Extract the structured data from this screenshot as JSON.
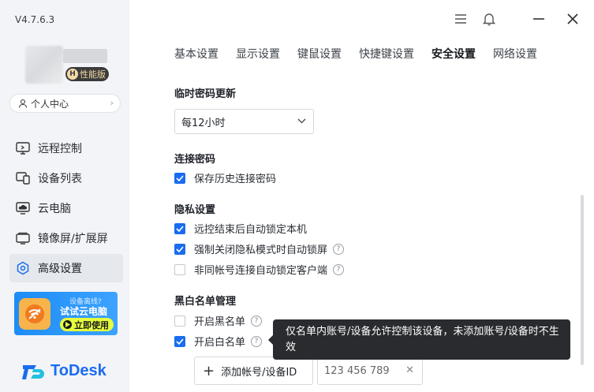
{
  "app": {
    "version": "V4.7.6.3",
    "badge_letter": "H",
    "badge_label": "性能版",
    "profile_label": "个人中心",
    "brand": "ToDesk"
  },
  "sidebar": {
    "items": [
      {
        "label": "远程控制",
        "icon": "monitor-icon"
      },
      {
        "label": "设备列表",
        "icon": "devices-icon"
      },
      {
        "label": "云电脑",
        "icon": "cloud-pc-icon"
      },
      {
        "label": "镜像屏/扩展屏",
        "icon": "mirror-screen-icon"
      },
      {
        "label": "高级设置",
        "icon": "settings-hex-icon",
        "active": true
      }
    ],
    "promo": {
      "line1": "设备离线?",
      "line2": "试试云电脑",
      "line3": "立即使用"
    }
  },
  "tabs": [
    {
      "label": "基本设置"
    },
    {
      "label": "显示设置"
    },
    {
      "label": "键鼠设置"
    },
    {
      "label": "快捷键设置"
    },
    {
      "label": "安全设置",
      "active": true
    },
    {
      "label": "网络设置"
    }
  ],
  "security": {
    "temp_password": {
      "title": "临时密码更新",
      "selected": "每12小时"
    },
    "connect_password": {
      "title": "连接密码",
      "save_history": {
        "label": "保存历史连接密码",
        "checked": true
      }
    },
    "privacy": {
      "title": "隐私设置",
      "auto_lock": {
        "label": "远控结束后自动锁定本机",
        "checked": true
      },
      "force_lock": {
        "label": "强制关闭隐私模式时自动锁屏",
        "checked": true
      },
      "diff_account_lock": {
        "label": "非同帐号连接自动锁定客户端",
        "checked": false
      }
    },
    "blackwhite": {
      "title": "黑白名单管理",
      "blacklist": {
        "label": "开启黑名单",
        "checked": false
      },
      "whitelist": {
        "label": "开启白名单",
        "checked": true
      },
      "add_button": "添加帐号/设备ID",
      "entries": [
        "123 456 789"
      ],
      "tooltip": "仅名单内账号/设备允许控制该设备，未添加账号/设备时不生效"
    }
  },
  "colors": {
    "accent": "#1a6cf0",
    "sidebar_bg": "#f2f4f7",
    "tooltip_bg": "#2a2b2e"
  }
}
